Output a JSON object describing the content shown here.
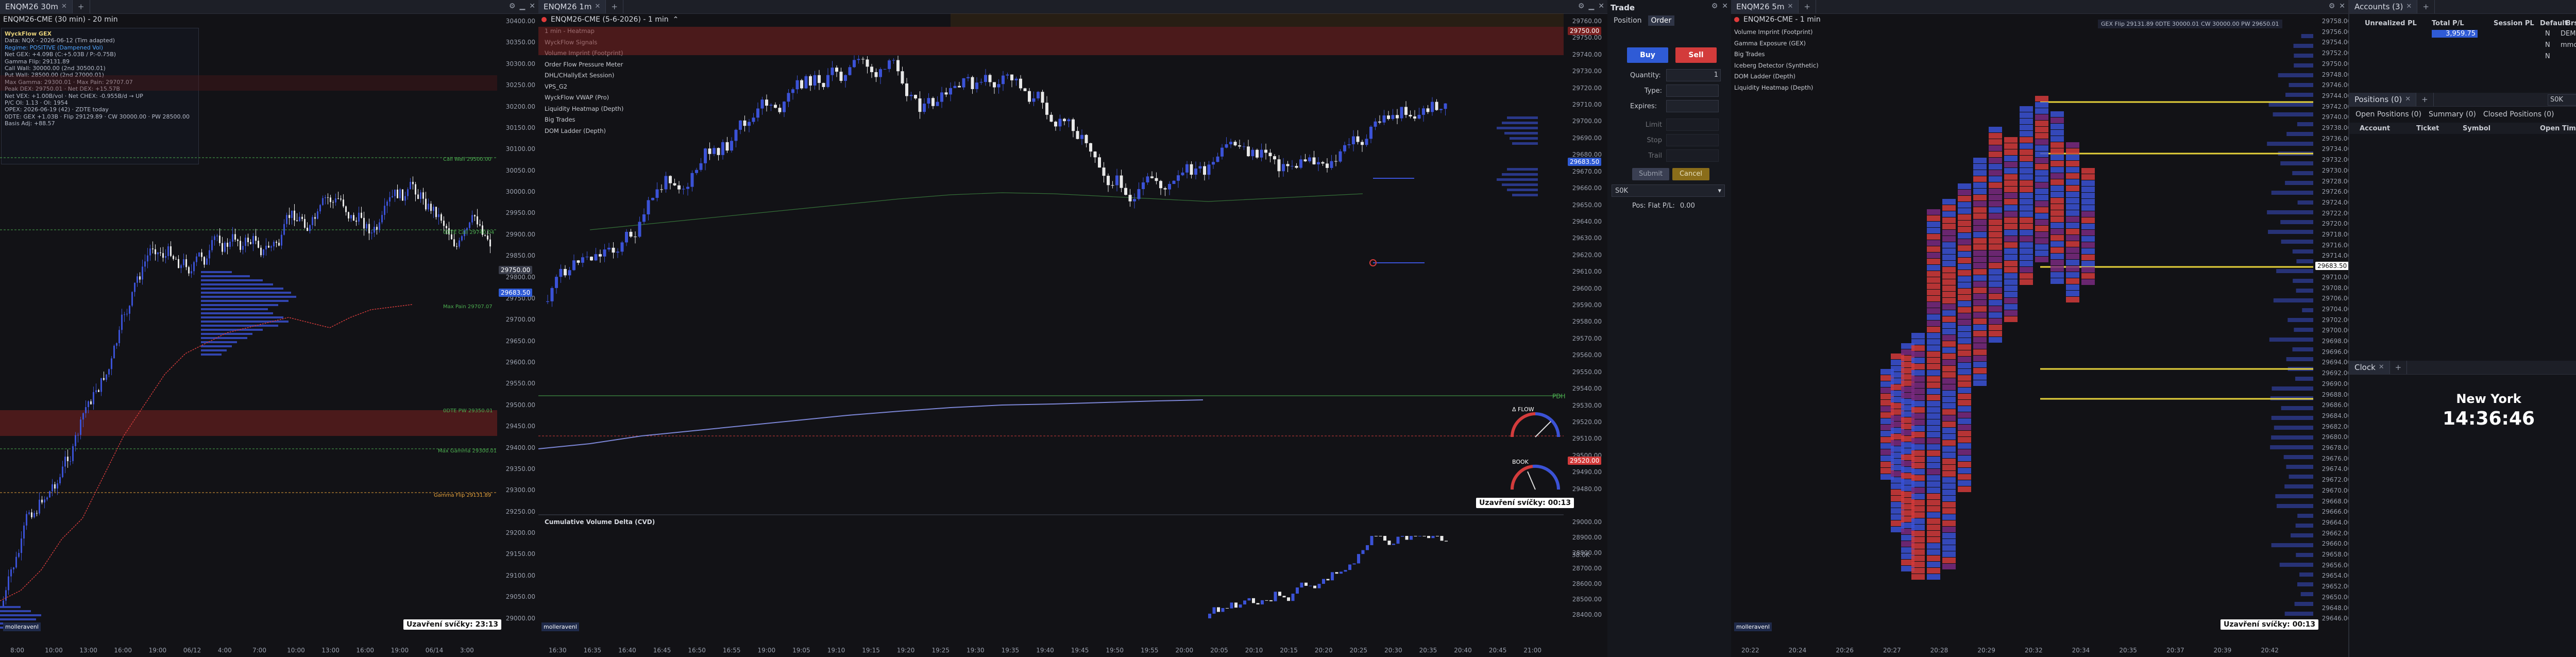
{
  "chart1": {
    "tab_label": "ENQM26 30m",
    "title": "ENQM26-CME (30 min) - 20 min",
    "info": {
      "header": "WyckFlow GEX",
      "lines": [
        "Data: NQX - 2026-06-12 (Tim adapted)",
        "Regime: POSITIVE (Dampened Vol)",
        "Net GEX: +4.09B (C:+5.03B / P:-0.75B)",
        "Gamma Flip: 29131.89",
        "Call Wall: 30000.00 (2nd 30500.01)",
        "Put Wall: 28500.00 (2nd 27000.01)",
        "Max Gamma: 29300.01 · Max Pain: 29707.07",
        "Peak DEX: 29750.01 · Net DEX: +15.57B",
        "Net VEX: +1.00B/vol · Net CHEX: -0.955B/d → UP",
        "P/C OI: 1.13 · OI: 1954",
        "OPEX: 2026-06-19 (42) · ZDTE today",
        "0DTE: GEX +1.03B · Flip 29129.89 · CW 30000.00 · PW 28500.00",
        "Basis Adj: +88.57"
      ]
    },
    "price_labels": [
      "30400.00",
      "30350.00",
      "30300.00",
      "30250.00",
      "30200.00",
      "30150.00",
      "30100.00",
      "30050.00",
      "30000.00",
      "29950.00",
      "29900.00",
      "29850.00",
      "29800.00",
      "29750.00",
      "29700.00",
      "29650.00",
      "29600.00",
      "29550.00",
      "29500.00",
      "29450.00",
      "29400.00",
      "29350.00",
      "29300.00",
      "29250.00",
      "29200.00",
      "29150.00",
      "29100.00",
      "29050.00",
      "29000.00"
    ],
    "time_labels": [
      "8:00",
      "10:00",
      "13:00",
      "16:00",
      "19:00",
      "06/12",
      "4:00",
      "7:00",
      "10:00",
      "13:00",
      "16:00",
      "19:00",
      "06/14",
      "3:00"
    ],
    "markers": [
      {
        "label": "Call Wall 29500.00"
      },
      {
        "label": "0DTE Call 29740.04"
      },
      {
        "label": "Max Pain 29707.07"
      },
      {
        "label": "0DTE PW 29350.01"
      },
      {
        "label": "Max Gamma 29300.01"
      },
      {
        "label": "Gamma Flip 29131.89"
      }
    ],
    "current_price": "29683.50",
    "last_price": "29750.00",
    "countdown": "Uzavření svíčky: 23:13",
    "watermark": "molleravenl"
  },
  "chart2": {
    "tab_label": "ENQM26 1m",
    "title": "ENQM26-CME (5-6-2026) - 1 min",
    "indicators": [
      "1 min - Heatmap",
      "WyckFlow Signals",
      "Volume Imprint (Footprint)",
      "Order Flow Pressure Meter",
      "DHL/CHallyExt Session)",
      "VPS_G2",
      "WyckFlow VWAP (Pro)",
      "Liquidity Heatmap (Depth)",
      "Big Trades",
      "DOM Ladder (Depth)"
    ],
    "price_labels": [
      "29760.00",
      "29750.00",
      "29740.00",
      "29730.00",
      "29720.00",
      "29710.00",
      "29700.00",
      "29690.00",
      "29680.00",
      "29670.00",
      "29660.00",
      "29650.00",
      "29640.00",
      "29630.00",
      "29620.00",
      "29610.00",
      "29600.00",
      "29590.00",
      "29580.00",
      "29570.00",
      "29560.00",
      "29550.00",
      "29540.00",
      "29530.00",
      "29520.00",
      "29510.00",
      "29500.00",
      "29490.00",
      "29480.00"
    ],
    "current_price": "29683.50",
    "level_label": "29750.00",
    "red_label": "29520.00",
    "pdh_label": "PDH",
    "gauge1_label": "Δ FLOW",
    "gauge2_label": "BOOK",
    "countdown": "Uzavření svíčky: 00:13",
    "cvd_title": "Cumulative Volume Delta (CVD)",
    "cvd_labels": [
      "29000.00",
      "28900.00",
      "28800.00",
      "28700.00",
      "28600.00",
      "28500.00",
      "28400.00"
    ],
    "cvd_value": "38.0K",
    "time_labels": [
      "16:30",
      "16:35",
      "16:40",
      "16:45",
      "16:50",
      "16:55",
      "19:00",
      "19:05",
      "19:10",
      "19:15",
      "19:20",
      "19:25",
      "19:30",
      "19:35",
      "19:40",
      "19:45",
      "19:50",
      "19:55",
      "20:00",
      "20:05",
      "20:10",
      "20:15",
      "20:20",
      "20:25",
      "20:30",
      "20:35",
      "20:40",
      "20:45",
      "21:00"
    ],
    "watermark": "molleravenl"
  },
  "trade": {
    "title": "Trade",
    "tabs": [
      "Position",
      "Order"
    ],
    "buy": "Buy",
    "sell": "Sell",
    "quantity_label": "Quantity:",
    "quantity_value": "1",
    "type_label": "Type:",
    "expires_label": "Expires:",
    "limit_label": "Limit",
    "stop_label": "Stop",
    "trail_label": "Trail",
    "submit": "Submit",
    "cancel": "Cancel",
    "account": "S0K",
    "pos_label": "Pos: Flat P/L:",
    "pos_value": "0.00"
  },
  "chart3": {
    "tab_label": "ENQM26 5m",
    "title": "ENQM26-CME - 1 min",
    "indicators": [
      "Volume Imprint (Footprint)",
      "Gamma Exposure (GEX)",
      "Big Trades",
      "Iceberg Detector (Synthetic)",
      "DOM Ladder (Depth)",
      "Liquidity Heatmap (Depth)"
    ],
    "top_info": "GEX Flip 29131.89  0DTE 30000.01  CW 30000.00  PW 29650.01",
    "price_labels": [
      "29758.00",
      "29756.00",
      "29754.00",
      "29752.00",
      "29750.00",
      "29748.00",
      "29746.00",
      "29744.00",
      "29742.00",
      "29740.00",
      "29738.00",
      "29736.00",
      "29734.00",
      "29732.00",
      "29730.00",
      "29728.00",
      "29726.00",
      "29724.00",
      "29722.00",
      "29720.00",
      "29718.00",
      "29716.00",
      "29714.00",
      "29712.00",
      "29710.00",
      "29708.00",
      "29706.00",
      "29704.00",
      "29702.00",
      "29700.00",
      "29698.00",
      "29696.00",
      "29694.00",
      "29692.00",
      "29690.00",
      "29688.00",
      "29686.00",
      "29684.00",
      "29682.00",
      "29680.00",
      "29678.00",
      "29676.00",
      "29674.00",
      "29672.00",
      "29670.00",
      "29668.00",
      "29666.00",
      "29664.00",
      "29662.00",
      "29660.00",
      "29658.00",
      "29656.00",
      "29654.00",
      "29652.00",
      "29650.00",
      "29648.00",
      "29646.00"
    ],
    "current_price": "29683.50",
    "time_labels": [
      "20:22",
      "20:24",
      "20:26",
      "20:27",
      "20:28",
      "20:29",
      "20:32",
      "20:34",
      "20:35",
      "20:37",
      "20:39",
      "20:42"
    ],
    "countdown": "Uzavření svíčky: 00:13",
    "watermark": "molleravenl"
  },
  "accounts": {
    "tab_label": "Accounts (3)",
    "columns": [
      "Unrealized PL",
      "Total P/L",
      "Session PL",
      "Default",
      "Brst",
      "Account"
    ],
    "rows": [
      {
        "total": "3,959.75",
        "name": "DEMO",
        "acct": "SIM",
        "flag": "N"
      },
      {
        "total": "",
        "name": "mmc",
        "acct": "DEMOCOMMISSION",
        "flag": "N"
      },
      {
        "total": "",
        "name": "",
        "acct": "S0K",
        "flag": "N"
      }
    ]
  },
  "positions": {
    "tab_label": "Positions (0)",
    "subtabs": [
      "Open Positions (0)",
      "Summary (0)",
      "Closed Positions (0)"
    ],
    "account": "S0K",
    "columns": [
      "Account",
      "Ticket",
      "Symbol",
      "Open Time",
      "Quantity"
    ]
  },
  "clock": {
    "tab_label": "Clock",
    "city": "New York",
    "time": "14:36:46"
  },
  "colors": {
    "bull": "#3b52d6",
    "bear": "#e8e8e8",
    "accent_red": "#d33b3b",
    "accent_yellow": "#e6d23b",
    "accent_green": "#4caf50"
  }
}
